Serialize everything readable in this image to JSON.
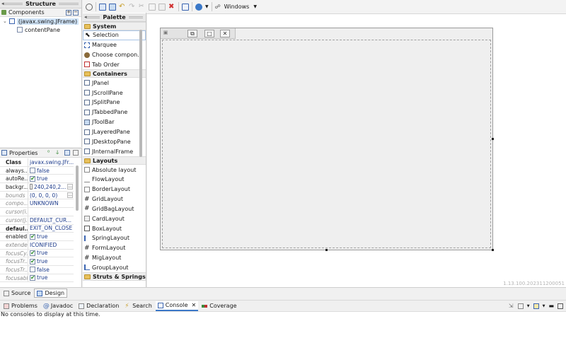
{
  "structure": {
    "title": "Structure",
    "components_label": "Components",
    "tree": [
      {
        "label": "(javax.swing.JFrame)"
      },
      {
        "label": "contentPane"
      }
    ]
  },
  "properties": {
    "title": "Properties",
    "rows": [
      {
        "key": "Class",
        "value": "javax.swing.JFr..."
      },
      {
        "key": "always...",
        "value": "false",
        "check": false
      },
      {
        "key": "autoRe...",
        "value": "true",
        "check": true
      },
      {
        "key": "backgr...",
        "value": "240,240,2...",
        "color": "#f0f0f0",
        "ellipsis": "..."
      },
      {
        "key": "bounds",
        "value": "(0, 0, 0, 0)",
        "ellipsis": "..."
      },
      {
        "key": "compo...",
        "value": "UNKNOWN"
      },
      {
        "key": "cursor(i...",
        "value": ""
      },
      {
        "key": "cursor(j...",
        "value": "DEFAULT_CUR..."
      },
      {
        "key": "defaul...",
        "value": "EXIT_ON_CLOSE"
      },
      {
        "key": "enabled",
        "value": "true",
        "check": true
      },
      {
        "key": "extende...",
        "value": "ICONIFIED"
      },
      {
        "key": "focusCy...",
        "value": "true",
        "check": true
      },
      {
        "key": "focusTr...",
        "value": "true",
        "check": true
      },
      {
        "key": "focusTr...",
        "value": "false",
        "check": false
      },
      {
        "key": "focusable",
        "value": "true",
        "check": true
      }
    ]
  },
  "palette": {
    "title": "Palette",
    "categories": [
      {
        "name": "System",
        "items": [
          "Selection",
          "Marquee",
          "Choose compon...",
          "Tab Order"
        ]
      },
      {
        "name": "Containers",
        "items": [
          "JPanel",
          "JScrollPane",
          "JSplitPane",
          "JTabbedPane",
          "JToolBar",
          "JLayeredPane",
          "JDesktopPane",
          "JInternalFrame"
        ]
      },
      {
        "name": "Layouts",
        "items": [
          "Absolute layout",
          "FlowLayout",
          "BorderLayout",
          "GridLayout",
          "GridBagLayout",
          "CardLayout",
          "BoxLayout",
          "SpringLayout",
          "FormLayout",
          "MigLayout",
          "GroupLayout"
        ]
      },
      {
        "name": "Struts & Springs",
        "items": []
      }
    ]
  },
  "toolbar": {
    "laf_label": "Windows"
  },
  "canvas": {
    "version": "1.13.100.202311200051"
  },
  "editor_tabs": {
    "source": "Source",
    "design": "Design"
  },
  "bottom": {
    "tabs": [
      "Problems",
      "Javadoc",
      "Declaration",
      "Search",
      "Console",
      "Coverage"
    ],
    "console_message": "No consoles to display at this time."
  },
  "icons": {
    "folder": "folder-icon",
    "selection": "arrow-cursor-icon",
    "console": "console-icon"
  },
  "colors": {
    "selection_bg": "#cfe3f7",
    "frame_bg": "#efefef",
    "accent": "#3c78c8"
  }
}
